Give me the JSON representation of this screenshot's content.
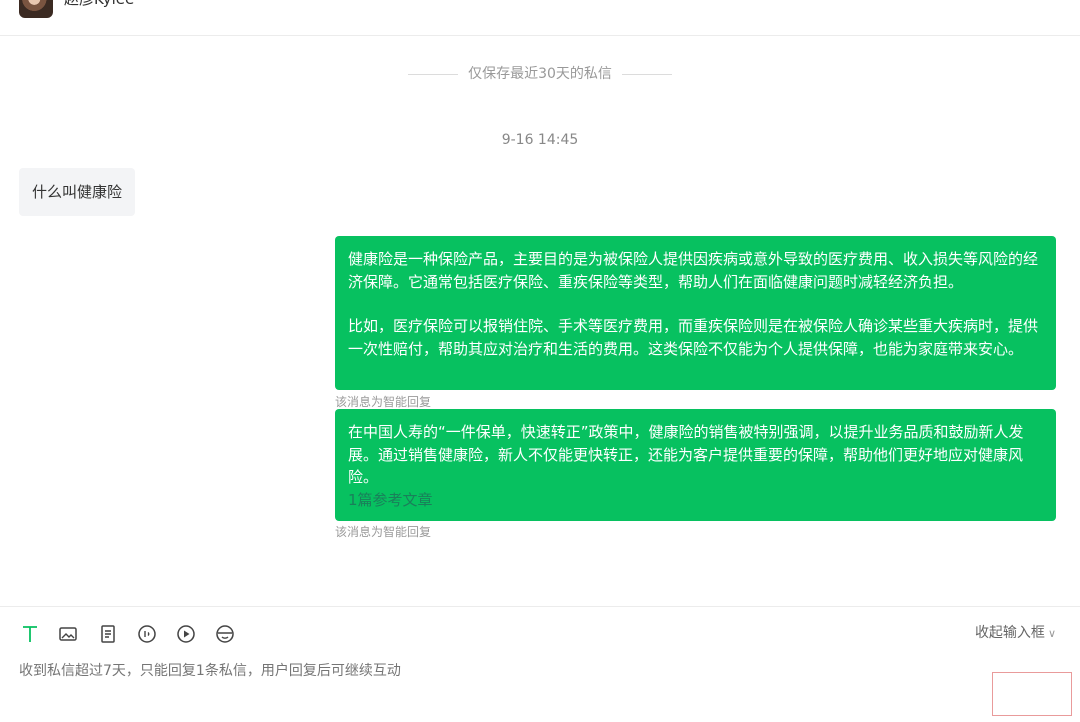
{
  "header": {
    "contact_name": "赵彦Kylee",
    "more_icon": "more-horizontal-icon"
  },
  "conversation": {
    "notice": "仅保存最近30天的私信",
    "timestamp": "9-16 14:45",
    "incoming": {
      "text": "什么叫健康险"
    },
    "replies": [
      {
        "paragraphs": [
          "健康险是一种保险产品，主要目的是为被保险人提供因疾病或意外导致的医疗费用、收入损失等风险的经济保障。它通常包括医疗保险、重疾保险等类型，帮助人们在面临健康问题时减轻经济负担。",
          "比如，医疗保险可以报销住院、手术等医疗费用，而重疾保险则是在被保险人确诊某些重大疾病时，提供一次性赔付，帮助其应对治疗和生活的费用。这类保险不仅能为个人提供保障，也能为家庭带来安心。"
        ],
        "note": "该消息为智能回复"
      },
      {
        "paragraphs": [
          "在中国人寿的“一件保单，快速转正”政策中，健康险的销售被特别强调，以提升业务品质和鼓励新人发展。通过销售健康险，新人不仅能更快转正，还能为客户提供重要的保障，帮助他们更好地应对健康风险。"
        ],
        "reference_link": "1篇参考文章",
        "note": "该消息为智能回复"
      }
    ]
  },
  "composer": {
    "tools": [
      "text-icon",
      "image-icon",
      "document-icon",
      "audio-icon",
      "video-play-icon",
      "sticker-icon"
    ],
    "collapse_label": "收起输入框",
    "input_placeholder": "收到私信超过7天，只能回复1条私信，用户回复后可继续互动"
  },
  "colors": {
    "accent_green": "#07c160",
    "text_icon_green": "#07c160"
  }
}
